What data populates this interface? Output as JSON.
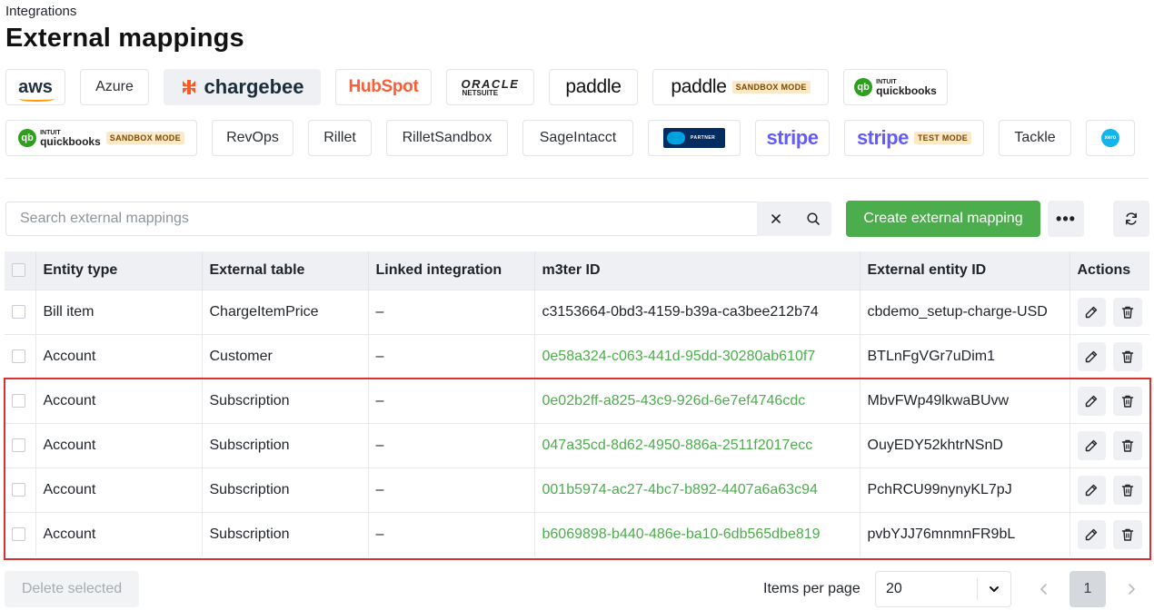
{
  "header": {
    "breadcrumb": "Integrations",
    "title": "External mappings"
  },
  "integrations": {
    "selected": "chargebee",
    "row1": [
      {
        "id": "aws",
        "text": "aws"
      },
      {
        "id": "azure",
        "text": "Azure"
      },
      {
        "id": "chargebee",
        "text": "chargebee"
      },
      {
        "id": "hubspot",
        "text": "HubSpot"
      },
      {
        "id": "oracle-netsuite",
        "text_top": "ORACLE",
        "text_bottom": "NETSUITE"
      },
      {
        "id": "paddle",
        "text": "paddle"
      },
      {
        "id": "paddle-sandbox",
        "text": "paddle",
        "badge": "SANDBOX MODE"
      },
      {
        "id": "quickbooks",
        "text_top": "INTUIT",
        "text_bottom": "quickbooks"
      }
    ],
    "row2": [
      {
        "id": "quickbooks-sandbox",
        "text_top": "INTUIT",
        "text_bottom": "quickbooks",
        "badge": "SANDBOX MODE"
      },
      {
        "id": "revops",
        "text": "RevOps"
      },
      {
        "id": "rillet",
        "text": "Rillet"
      },
      {
        "id": "rillet-sandbox",
        "text": "RilletSandbox"
      },
      {
        "id": "sage-intacct",
        "text": "SageIntacct"
      },
      {
        "id": "salesforce-partner",
        "text": "PARTNER"
      },
      {
        "id": "stripe",
        "text": "stripe"
      },
      {
        "id": "stripe-test",
        "text": "stripe",
        "badge": "TEST MODE"
      },
      {
        "id": "tackle",
        "text": "Tackle"
      },
      {
        "id": "xero",
        "text": "xero"
      }
    ]
  },
  "toolbar": {
    "search_placeholder": "Search external mappings",
    "search_value": "",
    "create_label": "Create external mapping",
    "more_label": "•••"
  },
  "table": {
    "columns": [
      "Entity type",
      "External table",
      "Linked integration",
      "m3ter ID",
      "External entity ID",
      "Actions"
    ],
    "rows": [
      {
        "entity_type": "Bill item",
        "external_table": "ChargeItemPrice",
        "linked_integration": "–",
        "m3ter_id": "c3153664-0bd3-4159-b39a-ca3bee212b74",
        "m3ter_id_link": false,
        "external_entity_id": "cbdemo_setup-charge-USD"
      },
      {
        "entity_type": "Account",
        "external_table": "Customer",
        "linked_integration": "–",
        "m3ter_id": "0e58a324-c063-441d-95dd-30280ab610f7",
        "m3ter_id_link": true,
        "external_entity_id": "BTLnFgVGr7uDim1"
      },
      {
        "entity_type": "Account",
        "external_table": "Subscription",
        "linked_integration": "–",
        "m3ter_id": "0e02b2ff-a825-43c9-926d-6e7ef4746cdc",
        "m3ter_id_link": true,
        "external_entity_id": "MbvFWp49lkwaBUvw"
      },
      {
        "entity_type": "Account",
        "external_table": "Subscription",
        "linked_integration": "–",
        "m3ter_id": "047a35cd-8d62-4950-886a-2511f2017ecc",
        "m3ter_id_link": true,
        "external_entity_id": "OuyEDY52khtrNSnD"
      },
      {
        "entity_type": "Account",
        "external_table": "Subscription",
        "linked_integration": "–",
        "m3ter_id": "001b5974-ac27-4bc7-b892-4407a6a63c94",
        "m3ter_id_link": true,
        "external_entity_id": "PchRCU99nynyKL7pJ"
      },
      {
        "entity_type": "Account",
        "external_table": "Subscription",
        "linked_integration": "–",
        "m3ter_id": "b6069898-b440-486e-ba10-6db565dbe819",
        "m3ter_id_link": true,
        "external_entity_id": "pvbYJJ76mnmnFR9bL"
      }
    ]
  },
  "footer": {
    "delete_label": "Delete selected",
    "items_per_page_label": "Items per page",
    "items_per_page_value": "20",
    "current_page": "1"
  },
  "colors": {
    "accent_green": "#4cad4c",
    "highlight_red": "#d93030",
    "chargebee_orange": "#ff5722",
    "hubspot_orange": "#ff5c35",
    "stripe_purple": "#635bff"
  }
}
